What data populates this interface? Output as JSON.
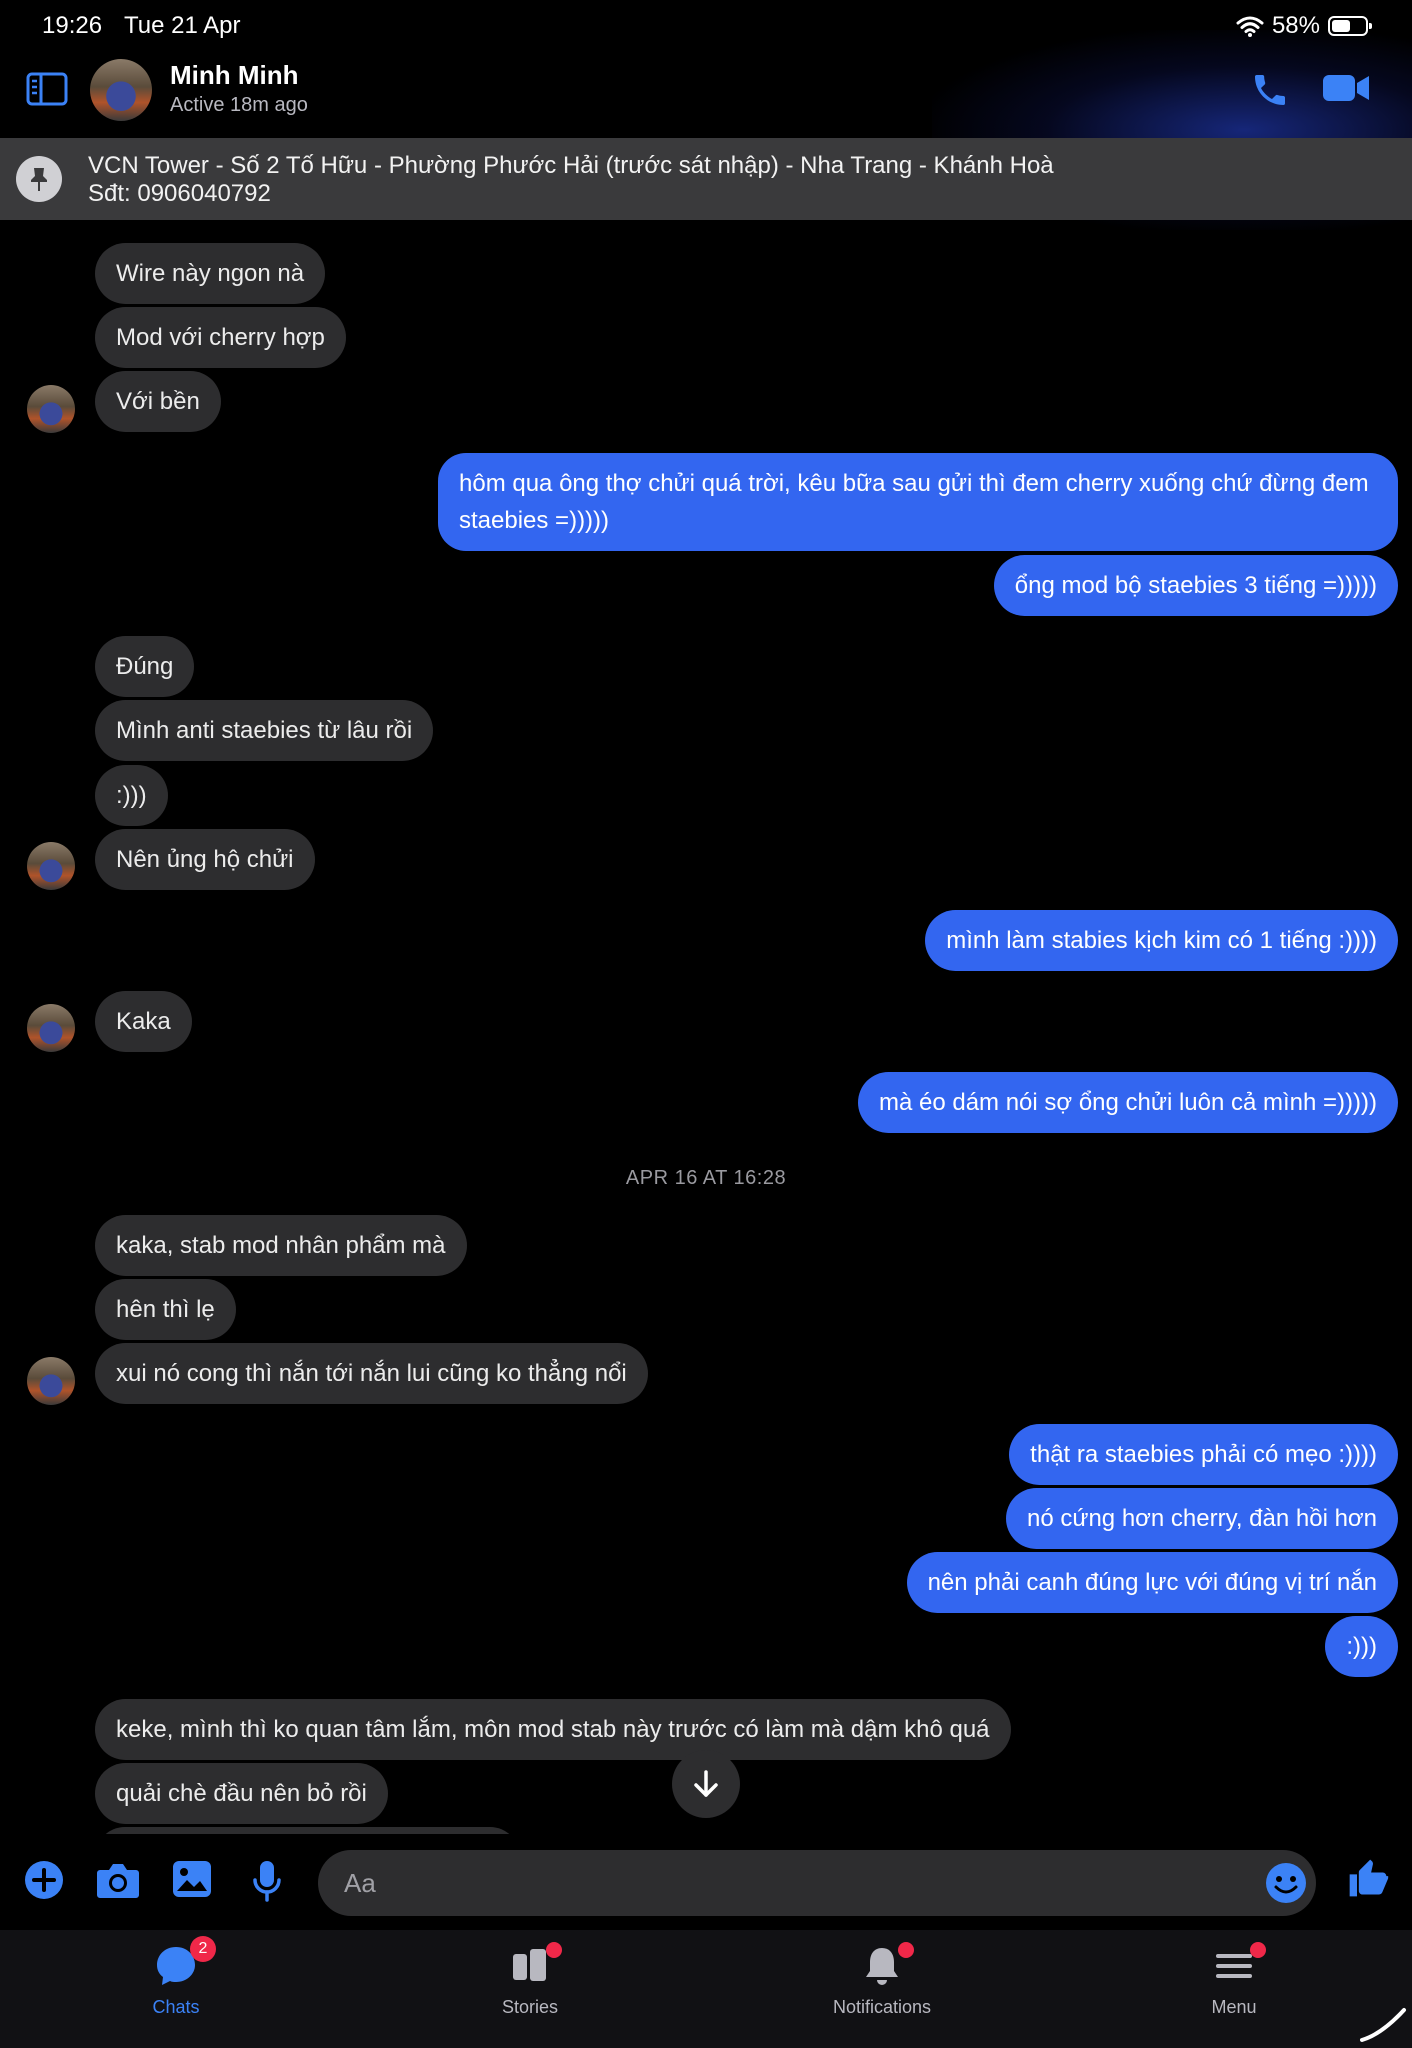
{
  "status_bar": {
    "time": "19:26",
    "date": "Tue 21 Apr",
    "battery": "58%"
  },
  "header": {
    "name": "Minh Minh",
    "active": "Active 18m ago"
  },
  "pinned": {
    "line1": "VCN Tower - Số 2 Tố Hữu - Phường Phước Hải (trước sát nhập) - Nha Trang - Khánh Hoà",
    "line2": "Sđt: 0906040792"
  },
  "messages": [
    {
      "from": "them",
      "text": "Wire này ngon nà"
    },
    {
      "from": "them",
      "text": "Mod với cherry hợp"
    },
    {
      "from": "them",
      "text": "Với bền"
    },
    {
      "from": "me",
      "text": "hôm qua ông thợ chửi quá trời, kêu bữa sau gửi thì đem cherry xuống chứ đừng đem staebies =)))))"
    },
    {
      "from": "me",
      "text": "ổng mod bộ staebies 3 tiếng =)))))"
    },
    {
      "from": "them",
      "text": "Đúng"
    },
    {
      "from": "them",
      "text": "Mình anti staebies từ lâu rồi"
    },
    {
      "from": "them",
      "text": ":)))"
    },
    {
      "from": "them",
      "text": "Nên ủng hộ chửi"
    },
    {
      "from": "me",
      "text": "mình làm stabies kịch kim có 1 tiếng :))))"
    },
    {
      "from": "them",
      "text": "Kaka"
    },
    {
      "from": "me",
      "text": "mà éo dám nói sợ ổng chửi luôn cả mình =)))))"
    },
    {
      "from": "them",
      "text": "kaka, stab mod nhân phẩm mà"
    },
    {
      "from": "them",
      "text": "hên thì lẹ"
    },
    {
      "from": "them",
      "text": "xui nó cong thì nắn tới nắn lui cũng ko thẳng nổi"
    },
    {
      "from": "me",
      "text": "thật ra staebies phải có mẹo :))))"
    },
    {
      "from": "me",
      "text": "nó cứng hơn cherry, đàn hồi hơn"
    },
    {
      "from": "me",
      "text": "nên phải canh đúng lực với đúng vị trí nắn"
    },
    {
      "from": "me",
      "text": ":)))"
    },
    {
      "from": "them",
      "text": "keke, mình thì ko quan tâm lắm, môn mod stab này trước có làm mà dậm khô quá"
    },
    {
      "from": "them",
      "text": "quải chè đầu nên bỏ rồi"
    }
  ],
  "timestamp": "APR 16 AT 16:28",
  "composer": {
    "placeholder": "Aa"
  },
  "tabs": [
    {
      "label": "Chats",
      "badge": "2",
      "active": true
    },
    {
      "label": "Stories",
      "dot": true
    },
    {
      "label": "Notifications",
      "dot": true
    },
    {
      "label": "Menu",
      "dot": true
    }
  ],
  "colors": {
    "accent": "#3366f0",
    "incoming_bubble": "#2d2d2f",
    "badge": "#f02849",
    "background": "#000000"
  }
}
